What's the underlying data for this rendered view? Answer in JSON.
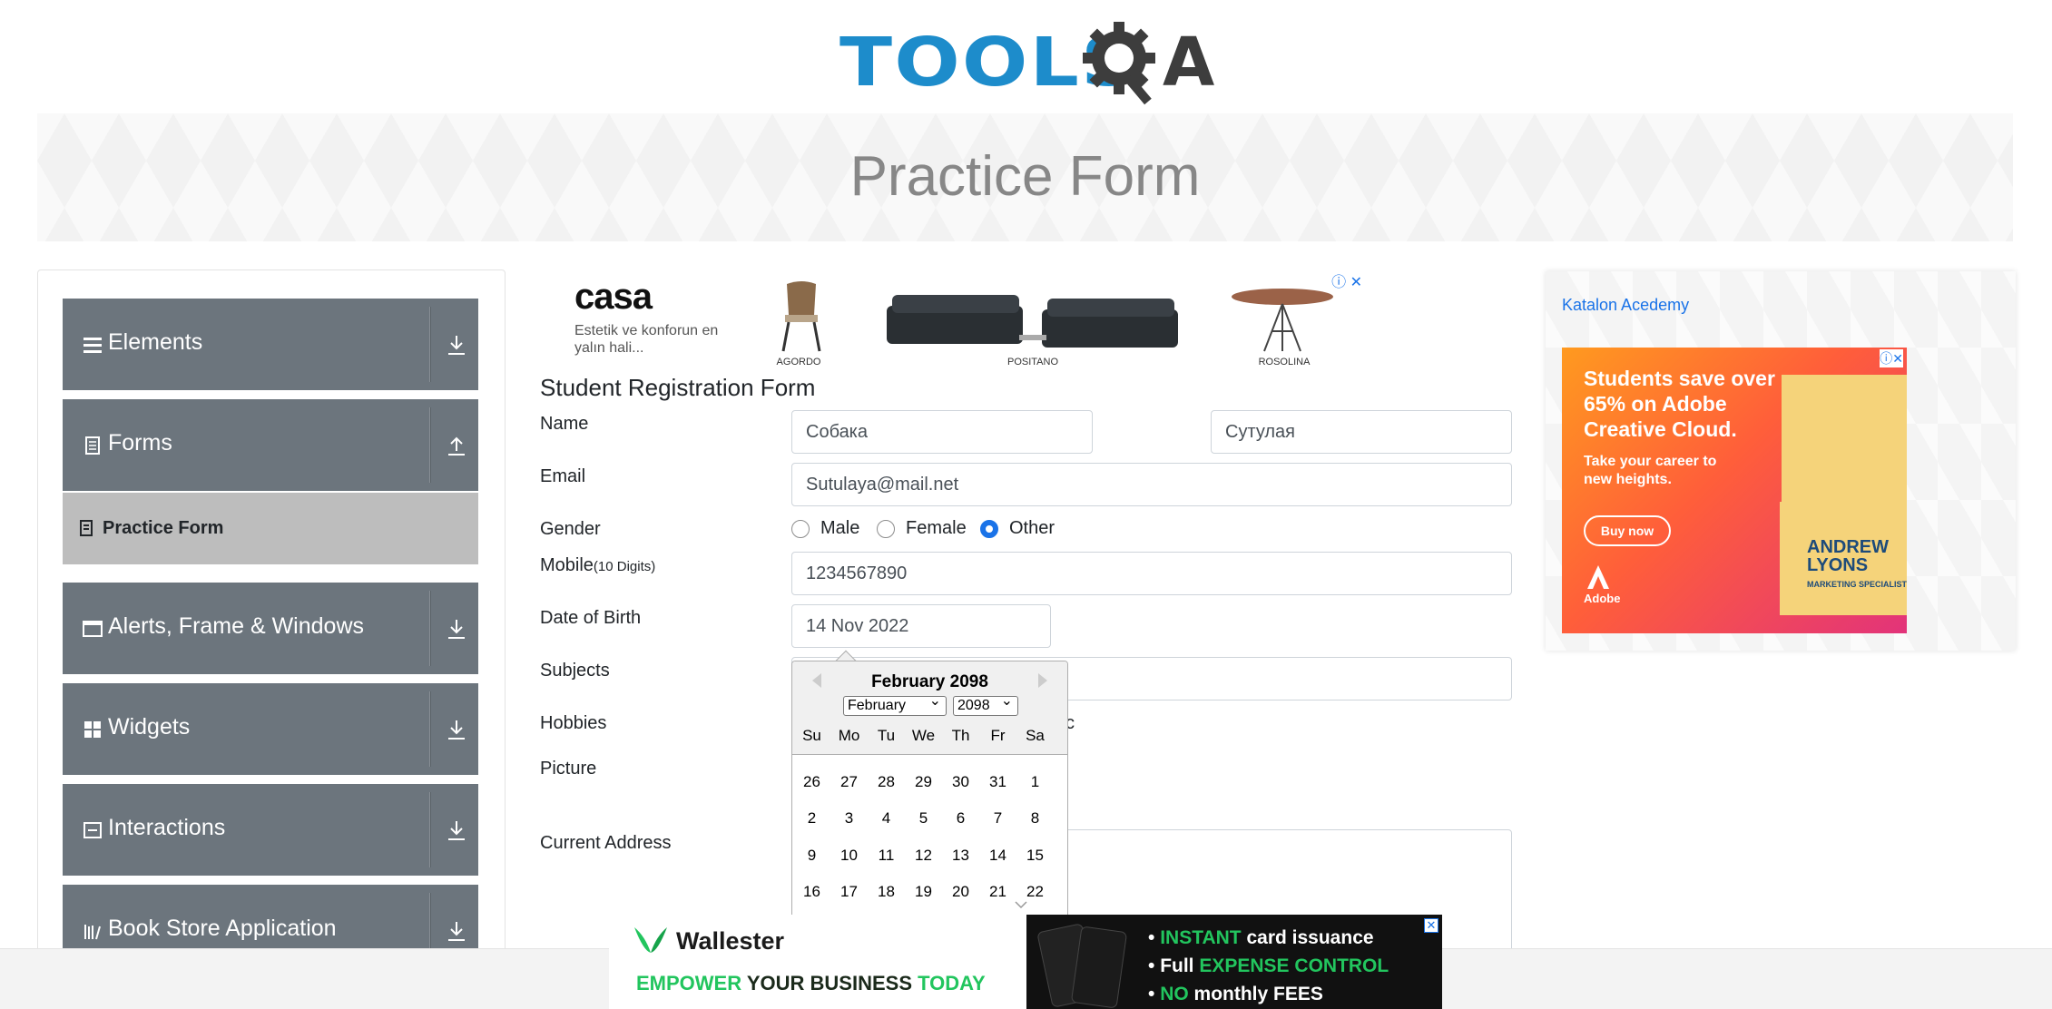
{
  "logo": {
    "text": "TOOLS",
    "tail": "A",
    "alt": "ToolsQA"
  },
  "banner": {
    "title": "Practice Form"
  },
  "sidebar": {
    "groups": [
      {
        "label": "Elements",
        "icon": "menu-icon"
      },
      {
        "label": "Forms",
        "icon": "document-icon"
      },
      {
        "label": "Alerts, Frame & Windows",
        "icon": "window-icon"
      },
      {
        "label": "Widgets",
        "icon": "grid-icon"
      },
      {
        "label": "Interactions",
        "icon": "interaction-icon"
      },
      {
        "label": "Book Store Application",
        "icon": "books-icon"
      }
    ],
    "active_item": {
      "label": "Practice Form",
      "icon": "form-icon"
    }
  },
  "top_ad": {
    "brand": "casa",
    "tagline": "Estetik ve konforun en yalın hali...",
    "products": [
      "AGORDO",
      "POSITANO",
      "ROSOLINA"
    ]
  },
  "form": {
    "title": "Student Registration Form",
    "name_label": "Name",
    "first_name": "Собака",
    "last_name": "Сутулая",
    "email_label": "Email",
    "email_value": "Sutulaya@mail.net",
    "gender_label": "Gender",
    "gender_options": [
      "Male",
      "Female",
      "Other"
    ],
    "gender_selected": "Other",
    "mobile_label": "Mobile",
    "mobile_hint": "(10 Digits)",
    "mobile_value": "1234567890",
    "dob_label": "Date of Birth",
    "dob_value": "14 Nov 2022",
    "subjects_label": "Subjects",
    "hobbies_label": "Hobbies",
    "hobbies_partial": "c",
    "picture_label": "Picture",
    "address_label": "Current Address"
  },
  "datepicker": {
    "header": "February 2098",
    "month_select": "February",
    "year_select": "2098",
    "day_names": [
      "Su",
      "Mo",
      "Tu",
      "We",
      "Th",
      "Fr",
      "Sa"
    ],
    "weeks": [
      [
        "26",
        "27",
        "28",
        "29",
        "30",
        "31",
        "1"
      ],
      [
        "2",
        "3",
        "4",
        "5",
        "6",
        "7",
        "8"
      ],
      [
        "9",
        "10",
        "11",
        "12",
        "13",
        "14",
        "15"
      ],
      [
        "16",
        "17",
        "18",
        "19",
        "20",
        "21",
        "22"
      ]
    ]
  },
  "right_ad": {
    "link": "Katalon Acedemy",
    "headline": "Students save over 65% on Adobe Creative Cloud.",
    "sub": "Take your career to new heights.",
    "button": "Buy now",
    "brand": "Adobe",
    "person": "ANDREW LYONS",
    "person_role": "MARKETING SPECIALIST"
  },
  "bottom_ad": {
    "brand": "Wallester",
    "tag_green1": "EMPOWER",
    "tag_dark": "YOUR BUSINESS",
    "tag_green2": "TODAY",
    "lines": [
      {
        "g": "INSTANT",
        "w": "card issuance",
        "prefix": ""
      },
      {
        "g": "EXPENSE CONTROL",
        "w": "",
        "prefix": "Full"
      },
      {
        "g": "NO",
        "w": "monthly FEES",
        "prefix": ""
      }
    ]
  },
  "colors": {
    "sidebar_bg": "#6c757d",
    "active_bg": "#bdbdbd",
    "accent": "#1a73e8",
    "logo_blue": "#1d8ccb"
  }
}
